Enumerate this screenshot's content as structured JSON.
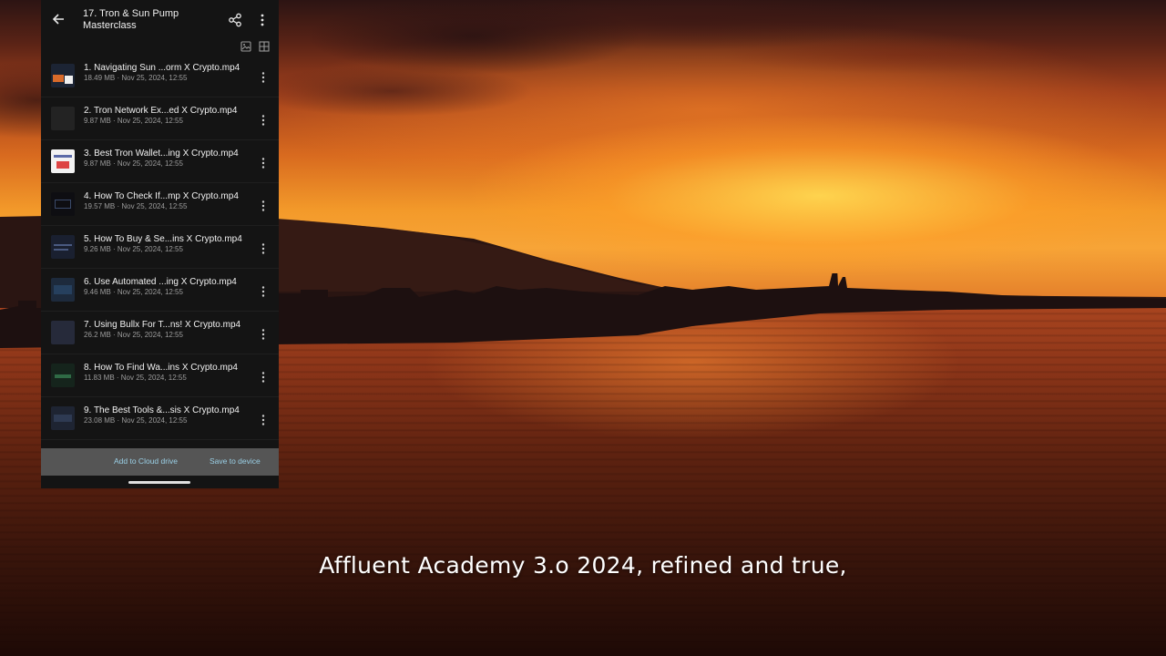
{
  "header": {
    "title": "17. Tron & Sun Pump\nMasterclass",
    "icons": {
      "back": "arrow-left-icon",
      "share": "share-icon",
      "more": "more-vertical-icon",
      "image_view": "image-view-icon",
      "grid_view": "grid-view-icon"
    }
  },
  "files": [
    {
      "name": "1. Navigating Sun ...orm   X Crypto.mp4",
      "meta": "18.49 MB · Nov 25, 2024, 12:55"
    },
    {
      "name": "2. Tron Network Ex...ed   X Crypto.mp4",
      "meta": "9.87 MB · Nov 25, 2024, 12:55"
    },
    {
      "name": "3. Best Tron Wallet...ing   X Crypto.mp4",
      "meta": "9.87 MB · Nov 25, 2024, 12:55"
    },
    {
      "name": "4. How To Check If...mp   X Crypto.mp4",
      "meta": "19.57 MB · Nov 25, 2024, 12:55"
    },
    {
      "name": "5. How To Buy & Se...ins   X Crypto.mp4",
      "meta": "9.26 MB · Nov 25, 2024, 12:55"
    },
    {
      "name": "6. Use Automated ...ing   X Crypto.mp4",
      "meta": "9.46 MB · Nov 25, 2024, 12:55"
    },
    {
      "name": "7. Using Bullx For T...ns!   X Crypto.mp4",
      "meta": "26.2 MB · Nov 25, 2024, 12:55"
    },
    {
      "name": "8. How To Find Wa...ins   X Crypto.mp4",
      "meta": "11.83 MB · Nov 25, 2024, 12:55"
    },
    {
      "name": "9. The Best Tools &...sis   X Crypto.mp4",
      "meta": "23.08 MB · Nov 25, 2024, 12:55"
    }
  ],
  "footer": {
    "add_cloud": "Add to Cloud drive",
    "save_device": "Save to device"
  },
  "subtitle": "Affluent Academy 3.o 2024, refined and true,",
  "colors": {
    "panel_bg": "#141414",
    "footer_bg": "#555555",
    "action_text": "#9ad0e6",
    "sky_top": "#2c1413",
    "sky_glow": "#f7a437",
    "sea": "#5e2210"
  }
}
